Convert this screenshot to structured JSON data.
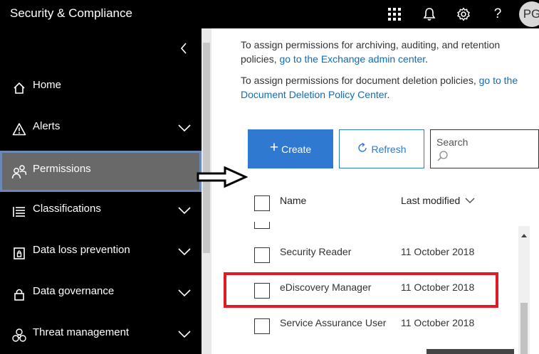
{
  "header": {
    "title": "Security & Compliance",
    "icons": [
      "app-launcher-icon",
      "bell-icon",
      "gear-icon",
      "help-icon"
    ],
    "help_label": "?",
    "avatar_initials": "PG"
  },
  "sidebar": {
    "collapse_icon": "chevron-left-icon",
    "items": [
      {
        "label": "Home",
        "icon": "home-icon",
        "expandable": false
      },
      {
        "label": "Alerts",
        "icon": "warning-icon",
        "expandable": true
      },
      {
        "label": "Permissions",
        "icon": "people-icon",
        "expandable": false,
        "selected": true
      },
      {
        "label": "Classifications",
        "icon": "list-icon",
        "expandable": true
      },
      {
        "label": "Data loss prevention",
        "icon": "shield-lock-icon",
        "expandable": true
      },
      {
        "label": "Data governance",
        "icon": "lock-icon",
        "expandable": true
      },
      {
        "label": "Threat management",
        "icon": "biohazard-icon",
        "expandable": true
      }
    ]
  },
  "main": {
    "info1": {
      "text": "To assign permissions for archiving, auditing, and retention policies, ",
      "link": "go to the Exchange admin center",
      "suffix": "."
    },
    "info2": {
      "text": "To assign permissions for document deletion policies, ",
      "link": "go to the Document Deletion Policy Center",
      "suffix": "."
    },
    "toolbar": {
      "create_label": "Create",
      "refresh_label": "Refresh",
      "search_placeholder": "Search"
    },
    "table": {
      "columns": [
        "Name",
        "Last modified"
      ],
      "rows": [
        {
          "name": "Security Reader",
          "modified": "11 October 2018"
        },
        {
          "name": "eDiscovery Manager",
          "modified": "11 October 2018",
          "highlighted": true
        },
        {
          "name": "Service Assurance User",
          "modified": "11 October 2018"
        }
      ]
    }
  },
  "colors": {
    "header_bg": "#000000",
    "selected_nav_bg": "#696969",
    "selected_nav_border": "#6a8ab5",
    "accent": "#2f79d1",
    "link": "#0a6ebd",
    "highlight": "#e01b24"
  }
}
